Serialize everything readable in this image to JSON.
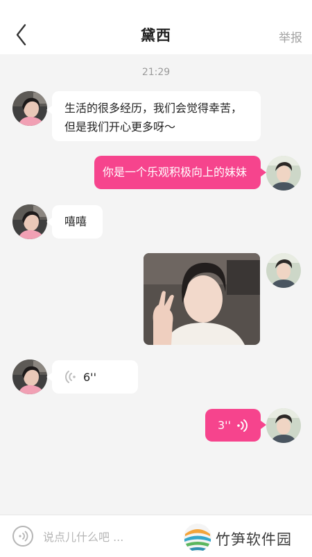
{
  "header": {
    "title": "黛西",
    "report_label": "举报"
  },
  "chat": {
    "timestamp": "21:29",
    "messages": [
      {
        "side": "left",
        "type": "text",
        "lines": [
          "生活的很多经历，我们会觉得幸苦，",
          "但是我们开心更多呀～"
        ]
      },
      {
        "side": "right",
        "type": "text",
        "text": "你是一个乐观积极向上的妹妹"
      },
      {
        "side": "left",
        "type": "text",
        "text": "嘻嘻"
      },
      {
        "side": "right",
        "type": "image"
      },
      {
        "side": "left",
        "type": "voice",
        "duration": "6''"
      },
      {
        "side": "right",
        "type": "voice",
        "duration": "3''"
      }
    ]
  },
  "footer": {
    "input_placeholder": "说点儿什么吧 ..."
  },
  "watermark": {
    "text": "竹笋软件园"
  },
  "colors": {
    "accent": "#f6448d",
    "background": "#f4f4f4",
    "bubble_left": "#ffffff"
  },
  "icons": {
    "back": "chevron-left-icon",
    "voice_toggle": "voice-icon",
    "voice_wave_left": "sound-wave-icon",
    "voice_wave_right": "sound-wave-icon"
  }
}
